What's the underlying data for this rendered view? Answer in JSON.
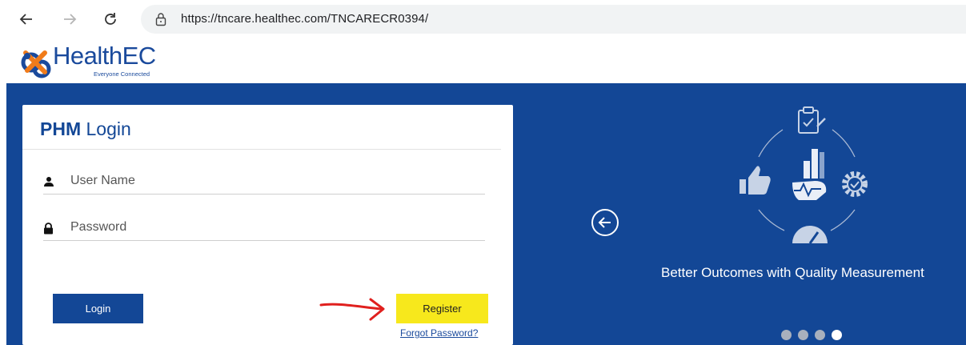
{
  "browser": {
    "url": "https://tncare.healthec.com/TNCARECR0394/"
  },
  "header": {
    "logo_name": "HealthEC",
    "logo_tagline": "Everyone Connected"
  },
  "login": {
    "title_strong": "PHM",
    "title_rest": " Login",
    "username_placeholder": "User Name",
    "password_placeholder": "Password",
    "login_label": "Login",
    "register_label": "Register",
    "forgot_label": "Forgot Password?"
  },
  "carousel": {
    "caption": "Better Outcomes with Quality Measurement",
    "slide_count": 4,
    "active_slide": 4
  },
  "icons": [
    "back-arrow-icon",
    "forward-arrow-icon",
    "reload-icon",
    "lock-icon",
    "user-icon",
    "padlock-icon",
    "chevron-left-icon",
    "clipboard-icon",
    "thumbs-up-icon",
    "gear-check-icon",
    "gauge-icon",
    "hand-chart-icon"
  ],
  "colors": {
    "brand_blue": "#134796",
    "register_yellow": "#f7e81c",
    "annotation_red": "#e0201e"
  }
}
